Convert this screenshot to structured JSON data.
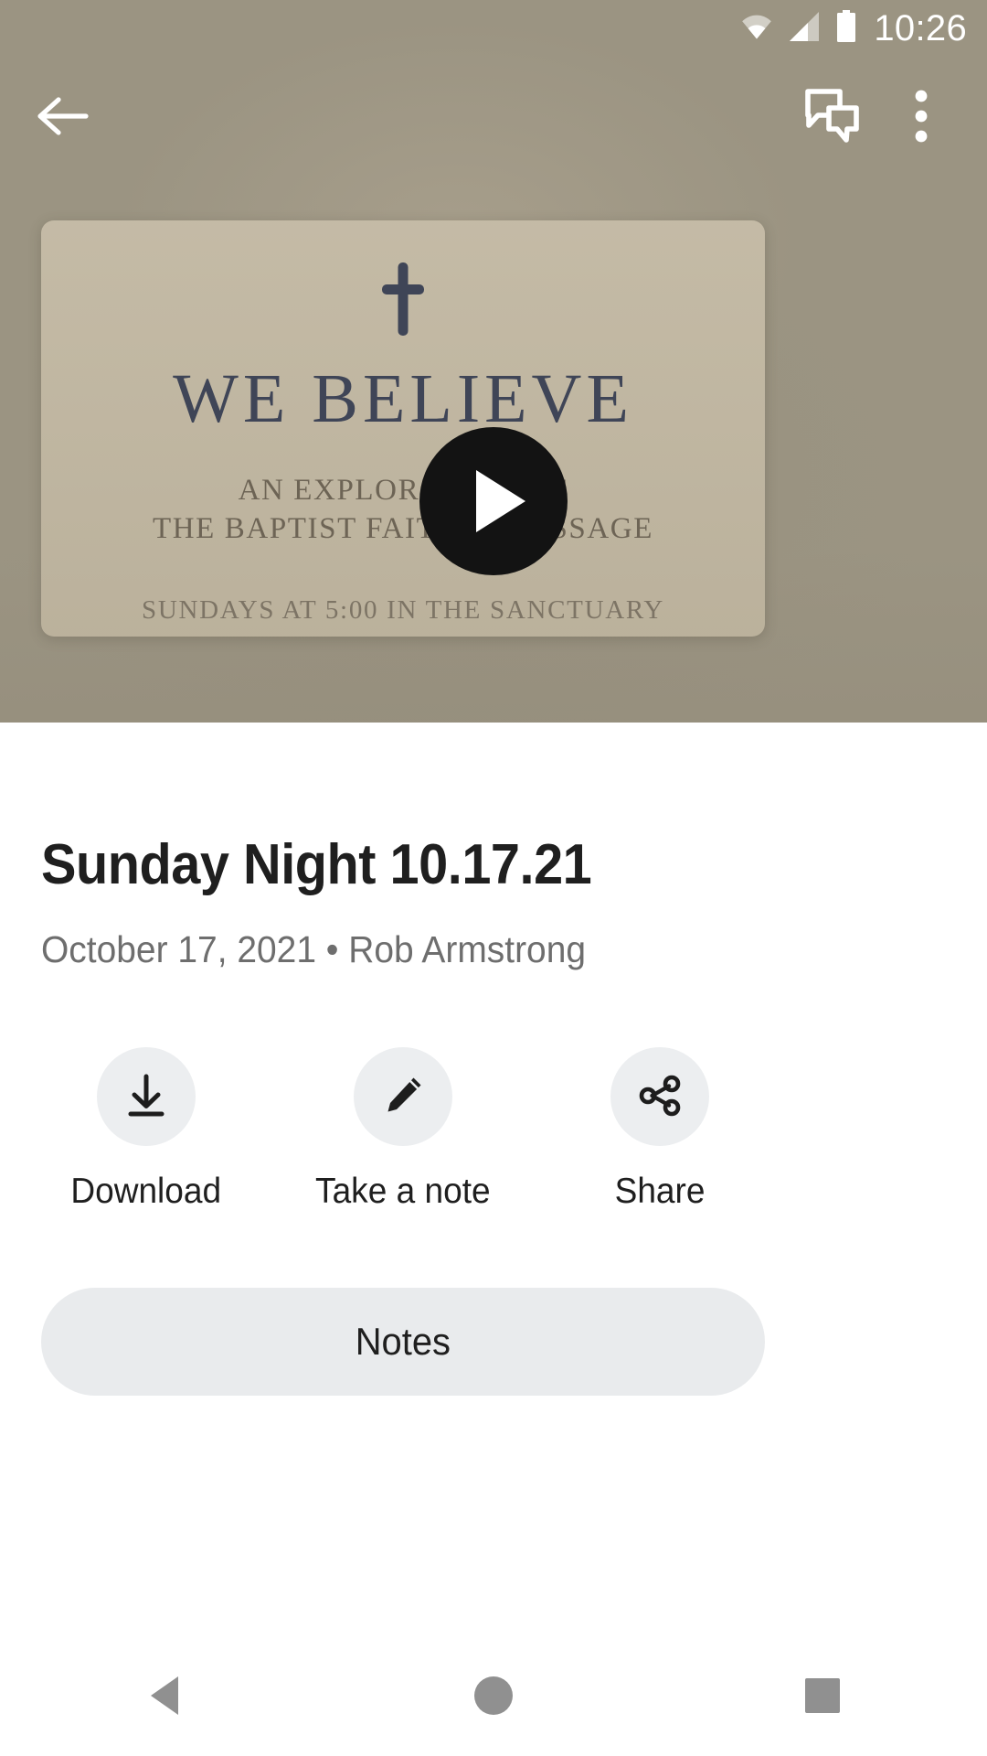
{
  "status_bar": {
    "time": "10:26",
    "icons": [
      "wifi-icon",
      "cellular-signal-icon",
      "battery-icon"
    ]
  },
  "app_bar": {
    "back_label": "Back",
    "chat_label": "Chat",
    "overflow_label": "More options",
    "icons": [
      "back-arrow-icon",
      "chat-bubbles-icon",
      "overflow-menu-icon"
    ]
  },
  "media": {
    "play_label": "Play",
    "thumbnail": {
      "icon": "cross-icon",
      "title": "WE BELIEVE",
      "subtitle_line1": "AN EXPLORATION OF",
      "subtitle_line2": "THE BAPTIST FAITH & MESSAGE",
      "footer": "SUNDAYS AT 5:00 IN THE SANCTUARY"
    }
  },
  "item": {
    "title": "Sunday Night 10.17.21",
    "meta": "October 17, 2021 • Rob Armstrong",
    "date": "October 17, 2021",
    "speaker": "Rob Armstrong"
  },
  "actions": [
    {
      "label": "Download",
      "icon": "download-icon"
    },
    {
      "label": "Take a note",
      "icon": "pencil-icon"
    },
    {
      "label": "Share",
      "icon": "share-icon"
    }
  ],
  "notes_button": {
    "label": "Notes"
  },
  "nav_bar": {
    "back_label": "Back",
    "home_label": "Home",
    "recents_label": "Recents",
    "icons": [
      "nav-back-triangle-icon",
      "nav-home-circle-icon",
      "nav-recents-square-icon"
    ]
  },
  "colors": {
    "hero_background": "#9b9482",
    "card_background": "#c1b7a1",
    "card_title_text": "#3f4557",
    "card_body_text": "#6d6455",
    "play_button": "#131313",
    "action_circle": "#eceef0",
    "notes_pill": "#e9ebed",
    "title_text": "#1f1f1f",
    "meta_text": "#6e6e6e",
    "nav_icon": "#909090",
    "status_icon": "#ffffff"
  }
}
